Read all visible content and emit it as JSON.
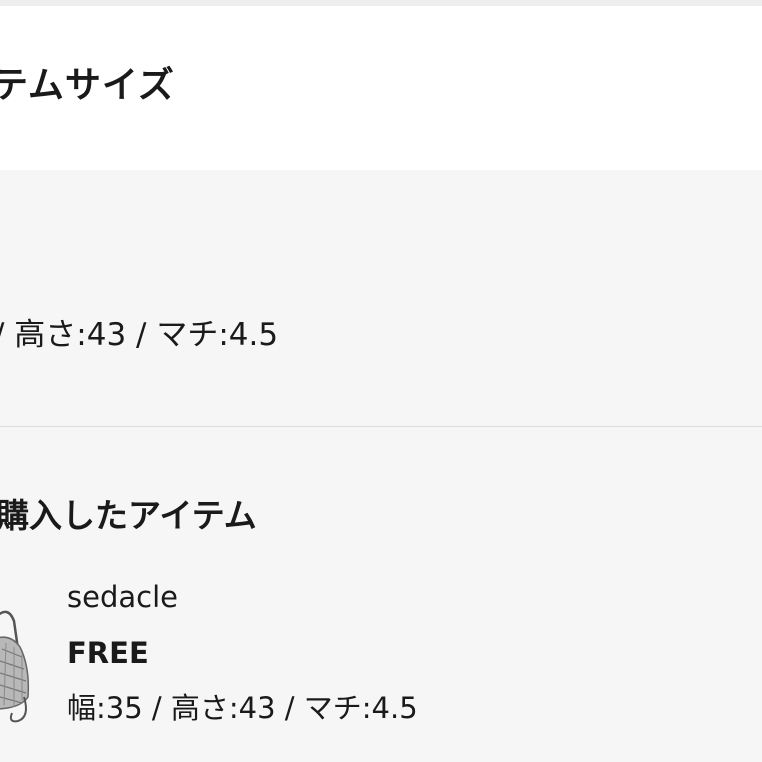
{
  "header": {
    "title": "テムサイズ"
  },
  "size_section": {
    "dimensions": "/ 高さ:43 / マチ:4.5"
  },
  "purchased_section": {
    "title": "購入したアイテム",
    "item": {
      "thumbnail_icon": "bag-thumbnail",
      "brand": "sedacle",
      "size": "FREE",
      "dimensions": "幅:35 / 高さ:43 / マチ:4.5"
    }
  }
}
